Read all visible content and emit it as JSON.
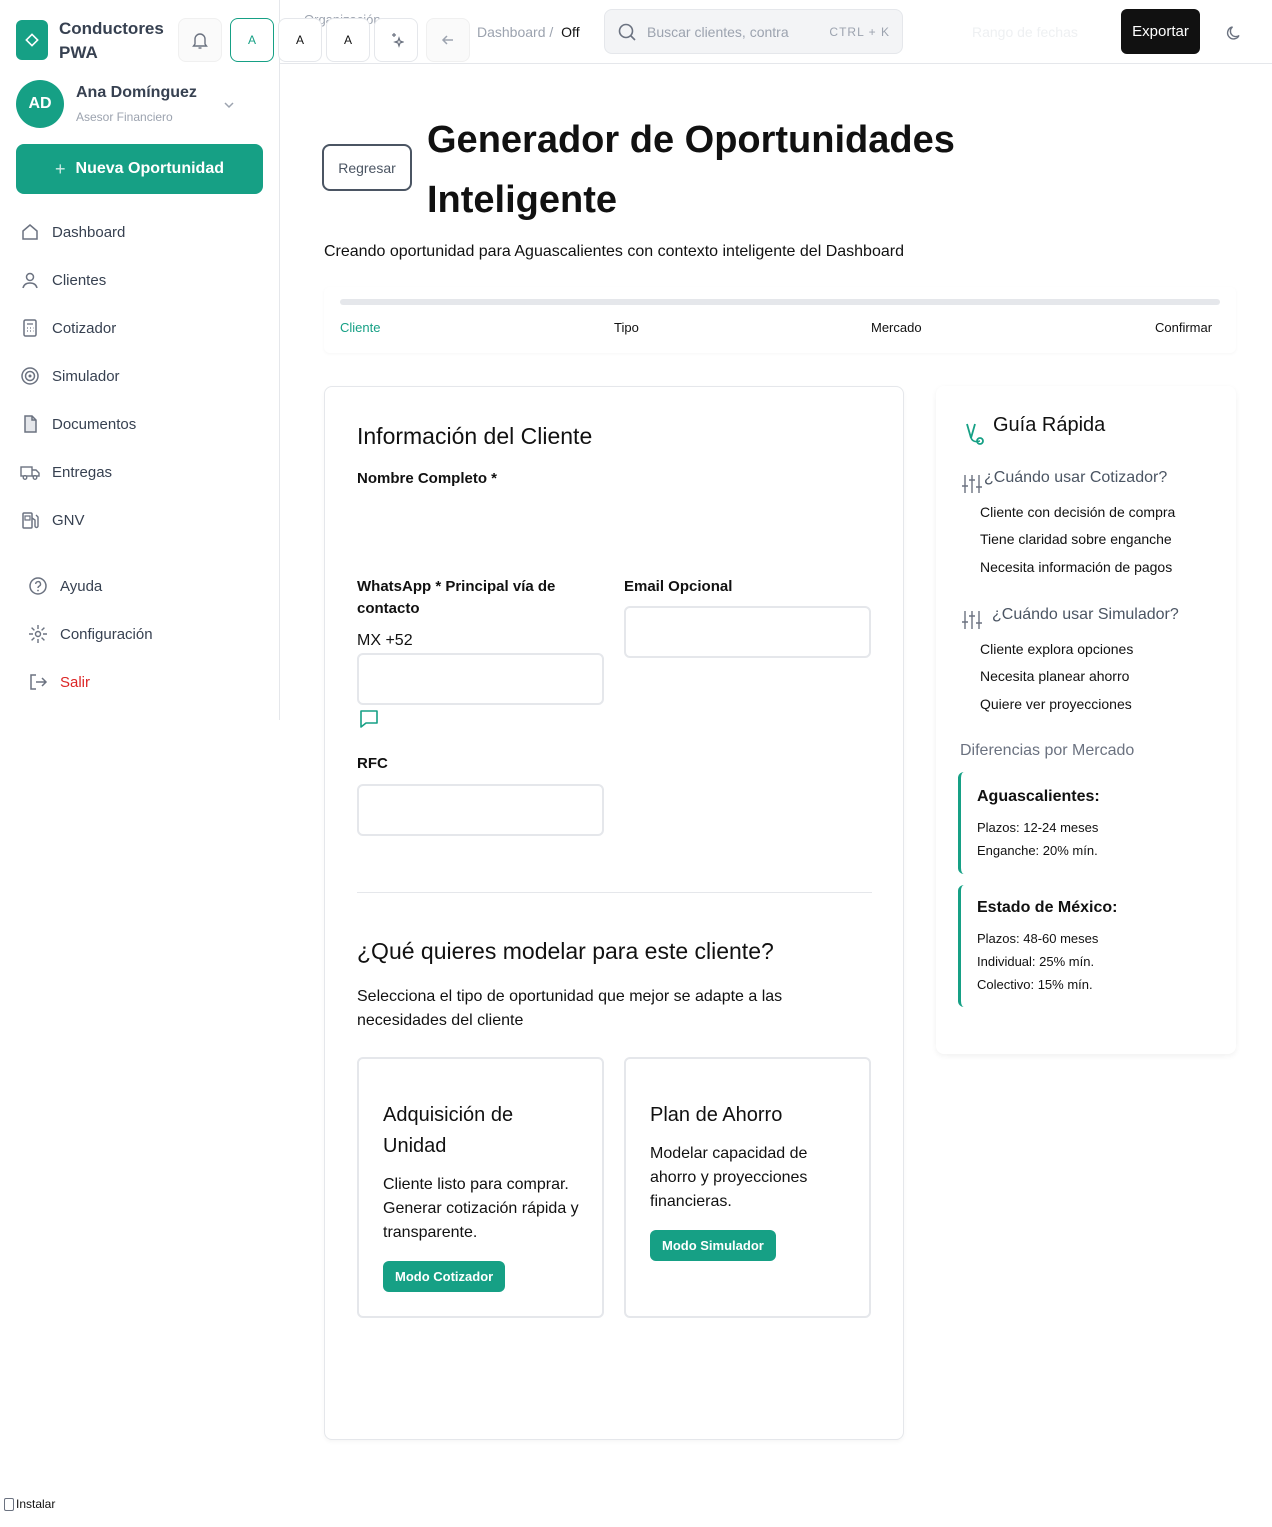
{
  "app": {
    "name": "Conductores PWA"
  },
  "topbar": {
    "org_label": "Organización",
    "icon_buttons": [
      "A",
      "A",
      "A"
    ],
    "breadcrumb": {
      "root": "Dashboard",
      "separator": "/",
      "current": "Off"
    },
    "search": {
      "placeholder": "Buscar clientes, contra",
      "shortcut": "CTRL + K"
    },
    "date_range": "Rango de fechas",
    "export_label": "Exportar"
  },
  "user": {
    "initials": "AD",
    "name": "Ana Domínguez",
    "role": "Asesor Financiero"
  },
  "sidebar": {
    "cta": "Nueva Oportunidad",
    "nav": [
      {
        "label": "Dashboard",
        "icon": "home-icon"
      },
      {
        "label": "Clientes",
        "icon": "user-icon"
      },
      {
        "label": "Cotizador",
        "icon": "calculator-icon"
      },
      {
        "label": "Simulador",
        "icon": "target-icon"
      },
      {
        "label": "Documentos",
        "icon": "document-icon"
      },
      {
        "label": "Entregas",
        "icon": "truck-icon"
      },
      {
        "label": "GNV",
        "icon": "fuel-icon"
      }
    ],
    "secondary": [
      {
        "label": "Ayuda",
        "icon": "help-icon"
      },
      {
        "label": "Configuración",
        "icon": "settings-icon"
      },
      {
        "label": "Salir",
        "icon": "logout-icon"
      }
    ]
  },
  "page": {
    "back_label": "Regresar",
    "title": "Generador de Oportunidades Inteligente",
    "subtitle": "Creando oportunidad para Aguascalientes con contexto inteligente del Dashboard",
    "steps": [
      "Cliente",
      "Tipo",
      "Mercado",
      "Confirmar"
    ],
    "active_step": "Cliente"
  },
  "form": {
    "section_title": "Información del Cliente",
    "name_label": "Nombre Completo *",
    "whatsapp_label": "WhatsApp * Principal vía de contacto",
    "whatsapp_prefix": "MX +52",
    "email_label": "Email Opcional",
    "rfc_label": "RFC",
    "values": {
      "name": "",
      "whatsapp": "",
      "email": "",
      "rfc": ""
    }
  },
  "model": {
    "title": "¿Qué quieres modelar para este cliente?",
    "description": "Selecciona el tipo de oportunidad que mejor se adapte a las necesidades del cliente",
    "options": [
      {
        "title": "Adquisición de Unidad",
        "description": "Cliente listo para comprar. Generar cotización rápida y transparente.",
        "button": "Modo Cotizador"
      },
      {
        "title": "Plan de Ahorro",
        "description": "Modelar capacidad de ahorro y proyecciones financieras.",
        "button": "Modo Simulador"
      }
    ]
  },
  "guide": {
    "title": "Guía Rápida",
    "cotizador": {
      "heading": "¿Cuándo usar Cotizador?",
      "items": [
        "Cliente con decisión de compra",
        "Tiene claridad sobre enganche",
        "Necesita información de pagos"
      ]
    },
    "simulador": {
      "heading": "¿Cuándo usar Simulador?",
      "items": [
        "Cliente explora opciones",
        "Necesita planear ahorro",
        "Quiere ver proyecciones"
      ]
    },
    "markets_title": "Diferencias por Mercado",
    "markets": [
      {
        "name": "Aguascalientes:",
        "lines": [
          "Plazos: 12-24 meses",
          "Enganche: 20% mín."
        ]
      },
      {
        "name": "Estado de México:",
        "lines": [
          "Plazos: 48-60 meses",
          "Individual: 25% mín.",
          "Colectivo: 15% mín."
        ]
      }
    ]
  },
  "install_label": "Instalar",
  "colors": {
    "accent": "#16a085",
    "danger": "#dc2626",
    "dark": "#111111"
  }
}
